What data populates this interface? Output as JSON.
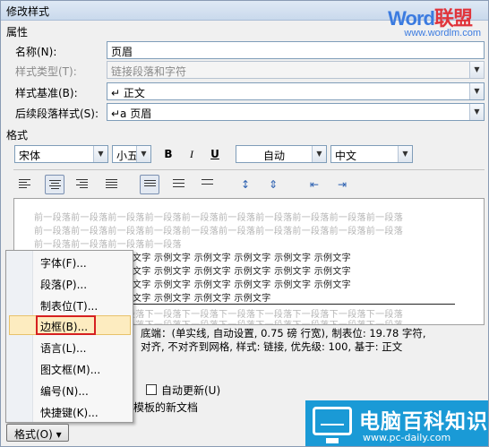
{
  "window": {
    "title": "修改样式"
  },
  "watermark": {
    "word_a": "Word",
    "word_b": "联盟",
    "url": "www.wordlm.com"
  },
  "properties": {
    "section_title": "属性",
    "name_label": "名称(N):",
    "name_value": "页眉",
    "type_label": "样式类型(T):",
    "type_value": "链接段落和字符",
    "based_label": "样式基准(B):",
    "based_value": "↵ 正文",
    "next_label": "后续段落样式(S):",
    "next_value": "↵a 页眉"
  },
  "format": {
    "section_title": "格式",
    "font": "宋体",
    "size": "小五",
    "bold": "B",
    "italic": "I",
    "underline": "U",
    "color": "自动",
    "language": "中文"
  },
  "preview": {
    "prev_lines": [
      "前一段落前一段落前一段落前一段落前一段落前一段落前一段落前一段落前一段落前一段落",
      "前一段落前一段落前一段落前一段落前一段落前一段落前一段落前一段落前一段落前一段落",
      "前一段落前一段落前一段落前一段落"
    ],
    "sample_lines": [
      "示例文字 示例文字 示例文字 示例文字 示例文字 示例文字 示例文字 示例文字",
      "示例文字 示例文字 示例文字 示例文字 示例文字 示例文字 示例文字 示例文字",
      "示例文字 示例文字 示例文字 示例文字 示例文字 示例文字 示例文字 示例文字",
      "示例文字 示例文字 示例文字 示例文字 示例文字 示例文字"
    ],
    "next_lines": [
      "下一段落下一段落下一段落下一段落下一段落下一段落下一段落下一段落下一段落下一段落",
      "下一段落下一段落下一段落下一段落下一段落下一段落下一段落下一段落下一段落下一段落"
    ]
  },
  "description": {
    "line1": "底端：(单实线, 自动设置, 0.75 磅 行宽), 制表位: 19.78 字符,",
    "line2": "对齐, 不对齐到网格, 样式: 链接, 优先级: 100, 基于: 正文"
  },
  "options": {
    "auto_update": "自动更新(U)",
    "new_docs_suffix": "模板的新文档"
  },
  "menu": {
    "items": [
      "字体(F)...",
      "段落(P)...",
      "制表位(T)...",
      "边框(B)...",
      "语言(L)...",
      "图文框(M)...",
      "编号(N)...",
      "快捷键(K)..."
    ]
  },
  "format_button": {
    "label": "格式(O) ▾"
  },
  "logo": {
    "name": "电脑百科知识",
    "url": "www.pc-daily.com"
  }
}
